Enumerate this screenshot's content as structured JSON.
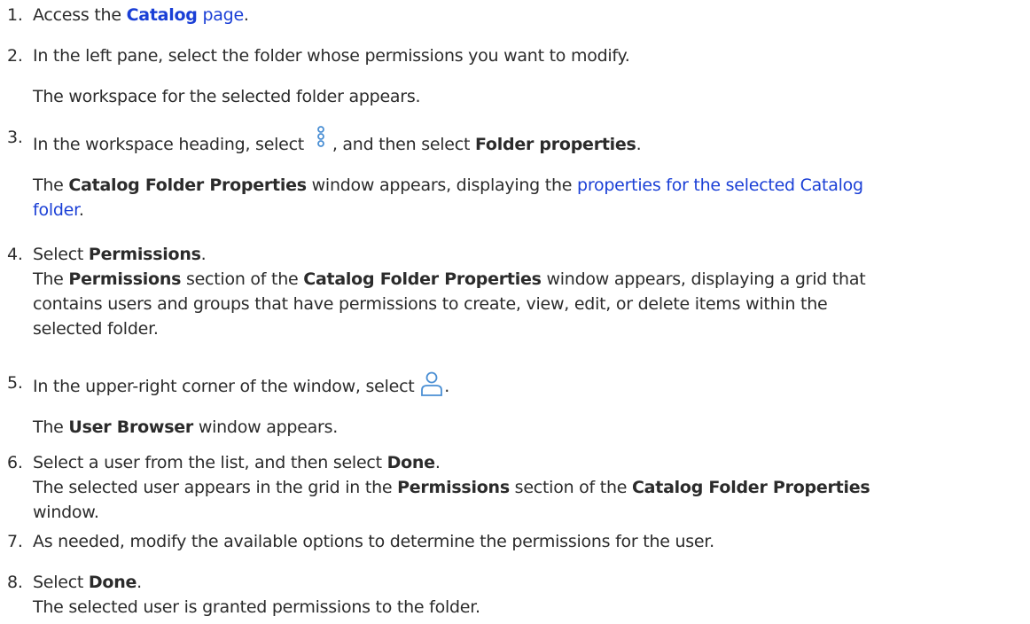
{
  "steps": [
    {
      "num": "1.",
      "pre": "Access the ",
      "link_bold": "Catalog",
      "link_after": " page",
      "post": "."
    },
    {
      "num": "2.",
      "text": "In the left pane, select the folder whose permissions you want to modify.",
      "result": "The workspace for the selected folder appears."
    },
    {
      "num": "3.",
      "pre": "In the workspace heading, select ",
      "icon": "more-options-icon",
      "mid": ", and then select ",
      "bold": "Folder properties",
      "post": ".",
      "result_bold": "Catalog Folder Properties",
      "result_mid": " window appears, displaying the ",
      "result_link_1": "properties for the selected Catalog",
      "result_link_2": "folder",
      "result_post": ".",
      "result_pre": "The "
    },
    {
      "num": "4.",
      "pre": "Select ",
      "bold": "Permissions",
      "post": ".",
      "r_pre": "The ",
      "r_b1": "Permissions",
      "r_mid": " section of the ",
      "r_b2": "Catalog Folder Properties",
      "r_l1": " window appears, displaying a grid that",
      "r_l2": "contains users and groups that have permissions to create, view, edit, or delete items within the",
      "r_l3": "selected folder."
    },
    {
      "num": "5.",
      "pre": "In the upper-right corner of the window, select ",
      "icon": "add-user-icon",
      "post": ".",
      "r_pre": "The ",
      "r_bold": "User Browser",
      "r_post": " window appears."
    },
    {
      "num": "6.",
      "pre": "Select a user from the list, and then select ",
      "bold": "Done",
      "post": ".",
      "r_l1a": "The selected user appears in the grid in the ",
      "r_b1": "Permissions",
      "r_mid": " section of the ",
      "r_b2": "Catalog Folder Properties",
      "r_l2": "window."
    },
    {
      "num": "7.",
      "text": "As needed, modify the available options to determine the permissions for the user."
    },
    {
      "num": "8.",
      "pre": "Select ",
      "bold": "Done",
      "post": ".",
      "result": "The selected user is granted permissions to the folder."
    }
  ],
  "colors": {
    "text": "#2b2b2b",
    "link": "#1a3fd6",
    "icon": "#4a8fd4"
  }
}
